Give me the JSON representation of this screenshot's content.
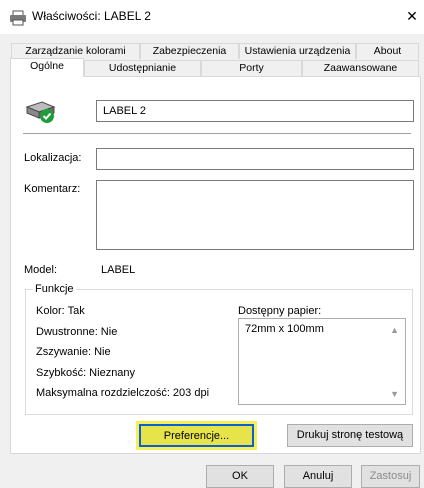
{
  "window": {
    "title": "Właściwości: LABEL 2",
    "close_glyph": "✕"
  },
  "tabs_row1": [
    "Zarządzanie kolorami",
    "Zabezpieczenia",
    "Ustawienia urządzenia",
    "About"
  ],
  "tabs_row2": [
    "Ogólne",
    "Udostępnianie",
    "Porty",
    "Zaawansowane"
  ],
  "general": {
    "printer_name": "LABEL 2",
    "location_label": "Lokalizacja:",
    "location_value": "",
    "comment_label": "Komentarz:",
    "comment_value": "",
    "model_label": "Model:",
    "model_value": "LABEL"
  },
  "features": {
    "legend": "Funkcje",
    "color": "Kolor: Tak",
    "duplex": "Dwustronne: Nie",
    "staple": "Zszywanie: Nie",
    "speed": "Szybkość: Nieznany",
    "max_resolution": "Maksymalna rozdzielczość: 203  dpi",
    "paper_label": "Dostępny papier:",
    "paper_items": [
      "72mm x 100mm"
    ]
  },
  "buttons": {
    "preferences": "Preferencje...",
    "print_test": "Drukuj stronę testową",
    "ok": "OK",
    "cancel": "Anuluj",
    "apply": "Zastosuj"
  },
  "icons": {
    "window": "printer-icon",
    "status": "printer-ready-icon"
  },
  "colors": {
    "highlight": "#e7e34a",
    "focus_border": "#0a5fd4",
    "ready_green": "#1e9e3a"
  }
}
